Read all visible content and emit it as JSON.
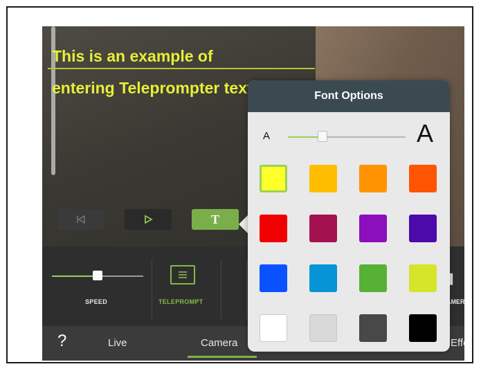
{
  "teleprompter": {
    "line1": "This is an example of",
    "line2": "entering Teleprompter text"
  },
  "controls": {
    "prev_icon": "skip-back-icon",
    "play_icon": "play-icon",
    "text_button_label": "T"
  },
  "toolbar": {
    "speed_label": "SPEED",
    "speed_value": 0.5,
    "teleprompt_label": "TELEPROMPT",
    "camera_partial_label": "AMER"
  },
  "tabs": {
    "help": "?",
    "items": [
      "Live",
      "Camera",
      "Effects"
    ],
    "selected": "Camera"
  },
  "font_options": {
    "title": "Font Options",
    "small_size_label": "A",
    "large_size_label": "A",
    "size_value": 0.27,
    "colors": [
      "#ffff29",
      "#ffbd00",
      "#ff9400",
      "#ff5400",
      "#f00000",
      "#a3124f",
      "#8b0fbd",
      "#4b0aa9",
      "#0a52ff",
      "#0594d5",
      "#57b135",
      "#d4e52a",
      "#ffffff",
      "#d8d8d8",
      "#484848",
      "#000000"
    ],
    "selected_color": "#ffff29"
  }
}
